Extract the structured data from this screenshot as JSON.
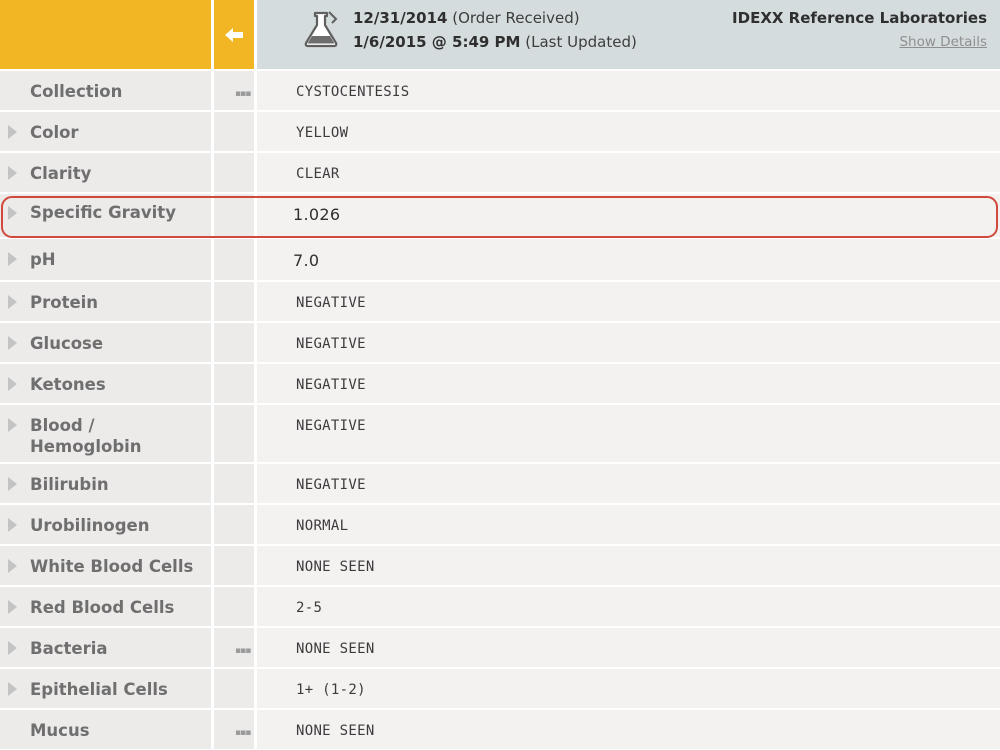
{
  "header": {
    "order_date": "12/31/2014",
    "order_status": "(Order Received)",
    "updated_date": "1/6/2015 @ 5:49 PM",
    "updated_status": "(Last Updated)",
    "lab_name": "IDEXX Reference Laboratories",
    "show_details_label": "Show Details",
    "back_icon": "arrow-left-icon",
    "flask_icon": "flask-icon"
  },
  "colors": {
    "accent": "#f2b625",
    "header_gray": "#d5dcdd",
    "highlight": "#cf4a3c"
  },
  "rows": [
    {
      "label": "Collection",
      "value": "CYSTOCENTESIS",
      "arrow": false,
      "dots": true
    },
    {
      "label": "Color",
      "value": "YELLOW",
      "arrow": true,
      "dots": false
    },
    {
      "label": "Clarity",
      "value": "CLEAR",
      "arrow": true,
      "dots": false
    },
    {
      "label": "Specific Gravity",
      "value": "1.026",
      "arrow": true,
      "dots": false,
      "numeric": true,
      "highlighted": true
    },
    {
      "label": "pH",
      "value": "7.0",
      "arrow": true,
      "dots": false,
      "numeric": true
    },
    {
      "label": "Protein",
      "value": "NEGATIVE",
      "arrow": true,
      "dots": false
    },
    {
      "label": "Glucose",
      "value": "NEGATIVE",
      "arrow": true,
      "dots": false
    },
    {
      "label": "Ketones",
      "value": "NEGATIVE",
      "arrow": true,
      "dots": false
    },
    {
      "label": "Blood / Hemoglobin",
      "value": "NEGATIVE",
      "arrow": true,
      "dots": false
    },
    {
      "label": "Bilirubin",
      "value": "NEGATIVE",
      "arrow": true,
      "dots": false
    },
    {
      "label": "Urobilinogen",
      "value": "NORMAL",
      "arrow": true,
      "dots": false
    },
    {
      "label": "White Blood Cells",
      "value": "NONE SEEN",
      "arrow": true,
      "dots": false
    },
    {
      "label": "Red Blood Cells",
      "value": "2-5",
      "arrow": true,
      "dots": false
    },
    {
      "label": "Bacteria",
      "value": "NONE SEEN",
      "arrow": true,
      "dots": true
    },
    {
      "label": "Epithelial Cells",
      "value": "1+ (1-2)",
      "arrow": true,
      "dots": false
    },
    {
      "label": "Mucus",
      "value": "NONE SEEN",
      "arrow": false,
      "dots": true
    }
  ]
}
